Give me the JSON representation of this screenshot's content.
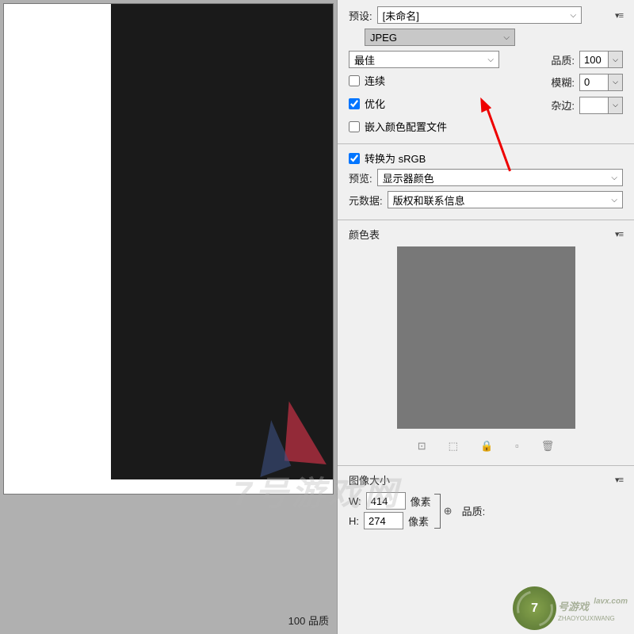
{
  "preset": {
    "label": "预设:",
    "value": "[未命名]"
  },
  "format": {
    "value": "JPEG"
  },
  "quality_mode": {
    "value": "最佳"
  },
  "quality": {
    "label": "品质:",
    "value": "100"
  },
  "blur": {
    "label": "模糊:",
    "value": "0"
  },
  "matte": {
    "label": "杂边:"
  },
  "checks": {
    "progressive": {
      "label": "连续",
      "checked": false
    },
    "optimized": {
      "label": "优化",
      "checked": true
    },
    "embed_profile": {
      "label": "嵌入颜色配置文件",
      "checked": false
    },
    "convert_srgb": {
      "label": "转换为 sRGB",
      "checked": true
    }
  },
  "preview": {
    "label": "预览:",
    "value": "显示器颜色"
  },
  "metadata": {
    "label": "元数据:",
    "value": "版权和联系信息"
  },
  "color_table": {
    "title": "颜色表"
  },
  "image_size": {
    "title": "图像大小",
    "w_label": "W:",
    "w_value": "414",
    "w_unit": "像素",
    "h_label": "H:",
    "h_value": "274",
    "h_unit": "像素",
    "quality_label": "品质:"
  },
  "status": {
    "zoom": "100",
    "label": "品质"
  },
  "watermark": {
    "text": "7号游戏网",
    "badge_num": "7",
    "badge_text": "号游戏",
    "sub": "ZHAOYOUXIWANG",
    "url": "lavx.com"
  }
}
